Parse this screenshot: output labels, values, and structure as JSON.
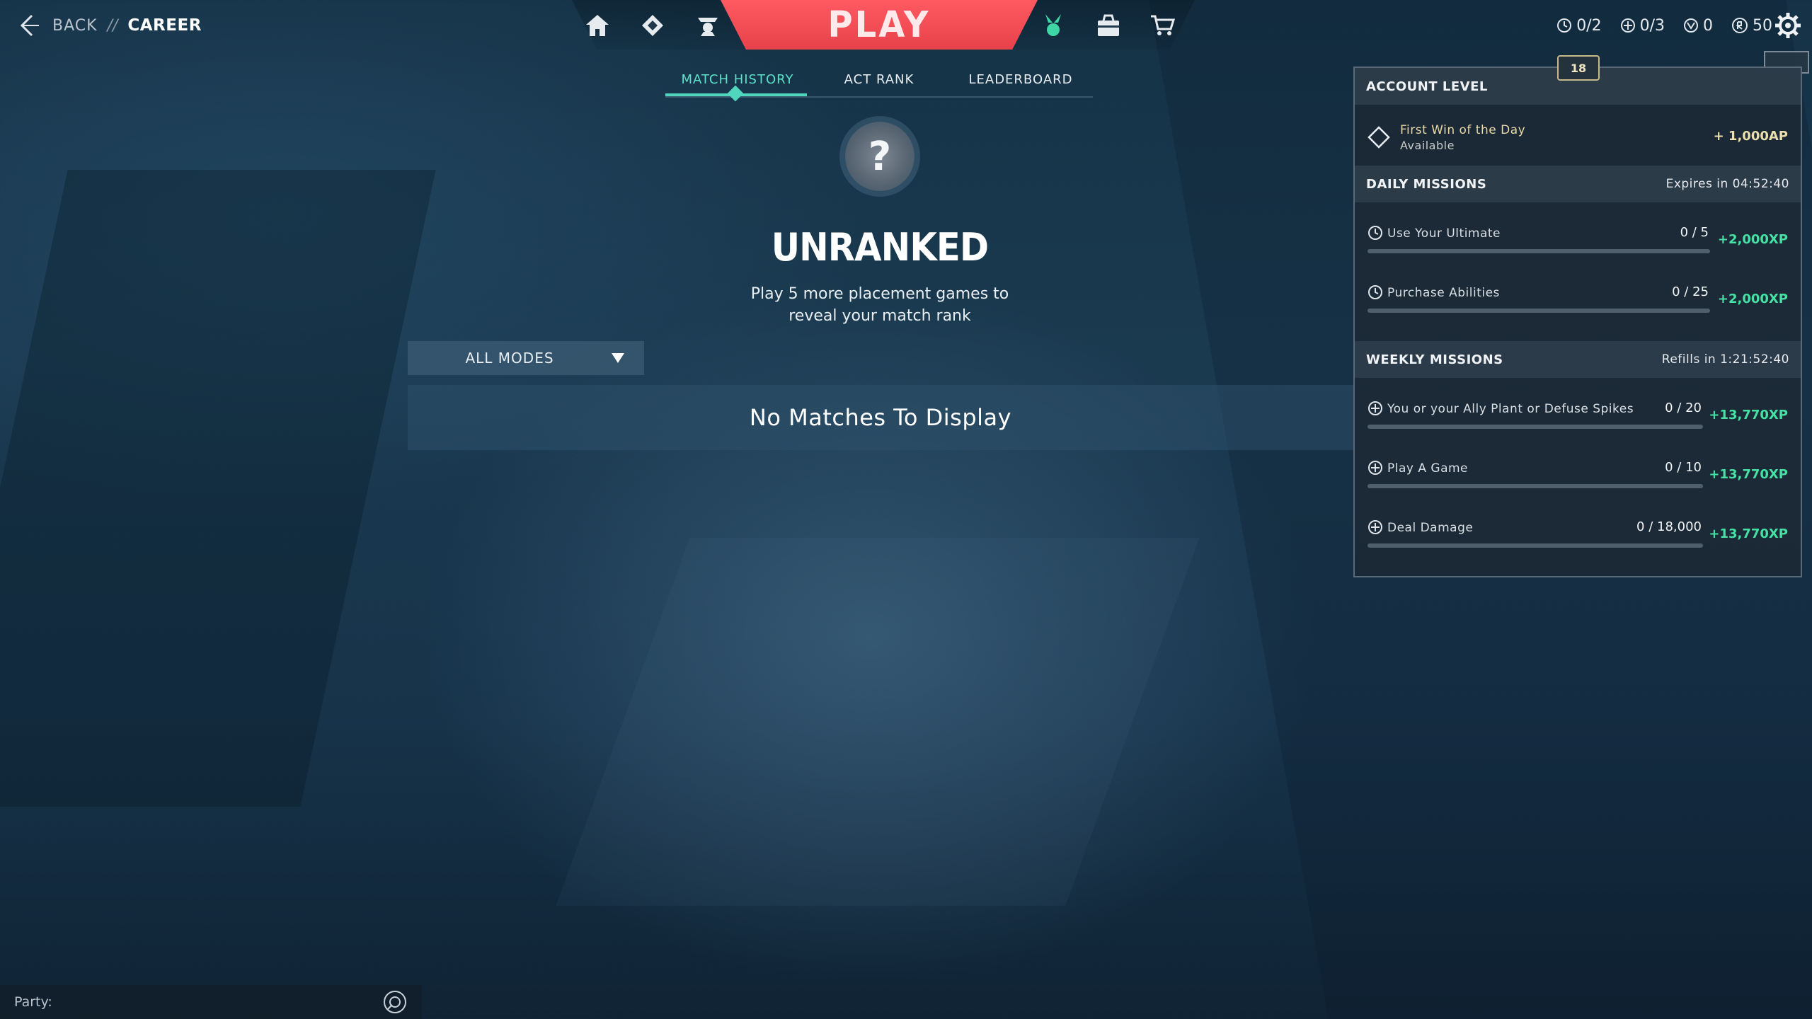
{
  "breadcrumb": {
    "back_label": "BACK",
    "separator": "//",
    "current": "CAREER"
  },
  "nav": {
    "left_icons": [
      "home-icon",
      "battlepass-icon",
      "agents-icon"
    ],
    "play_label": "PLAY",
    "right_icons": [
      "career-icon",
      "collection-icon",
      "store-icon"
    ]
  },
  "currencies": [
    {
      "icon": "clock-icon",
      "value": "0/2"
    },
    {
      "icon": "plus-circle-icon",
      "value": "0/3"
    },
    {
      "icon": "valorant-points-icon",
      "value": "0"
    },
    {
      "icon": "radianite-icon",
      "value": "50"
    }
  ],
  "subtabs": [
    "MATCH HISTORY",
    "ACT RANK",
    "LEADERBOARD"
  ],
  "rank": {
    "icon_glyph": "?",
    "title": "UNRANKED",
    "description_line1": "Play 5 more placement games to",
    "description_line2": "reveal your match rank"
  },
  "mode_select": {
    "value": "ALL MODES"
  },
  "matches": {
    "empty_text": "No Matches To Display"
  },
  "panel": {
    "badge": "18",
    "account_level": {
      "title": "ACCOUNT LEVEL",
      "first_win": "First Win of the Day",
      "first_win_status": "Available",
      "first_win_reward": "+ 1,000AP"
    },
    "daily": {
      "title": "DAILY MISSIONS",
      "timer": "Expires in 04:52:40",
      "missions": [
        {
          "name": "Use Your Ultimate",
          "progress": "0 / 5",
          "reward": "+2,000XP",
          "fraction": 0
        },
        {
          "name": "Purchase Abilities",
          "progress": "0 / 25",
          "reward": "+2,000XP",
          "fraction": 0
        }
      ]
    },
    "weekly": {
      "title": "WEEKLY MISSIONS",
      "timer": "Refills in 1:21:52:40",
      "missions": [
        {
          "name": "You or your Ally Plant or Defuse Spikes",
          "progress": "0 / 20",
          "reward": "+13,770XP",
          "fraction": 0
        },
        {
          "name": "Play A Game",
          "progress": "0 / 10",
          "reward": "+13,770XP",
          "fraction": 0
        },
        {
          "name": "Deal Damage",
          "progress": "0 / 18,000",
          "reward": "+13,770XP",
          "fraction": 0
        }
      ]
    }
  },
  "party": {
    "label": "Party:"
  }
}
